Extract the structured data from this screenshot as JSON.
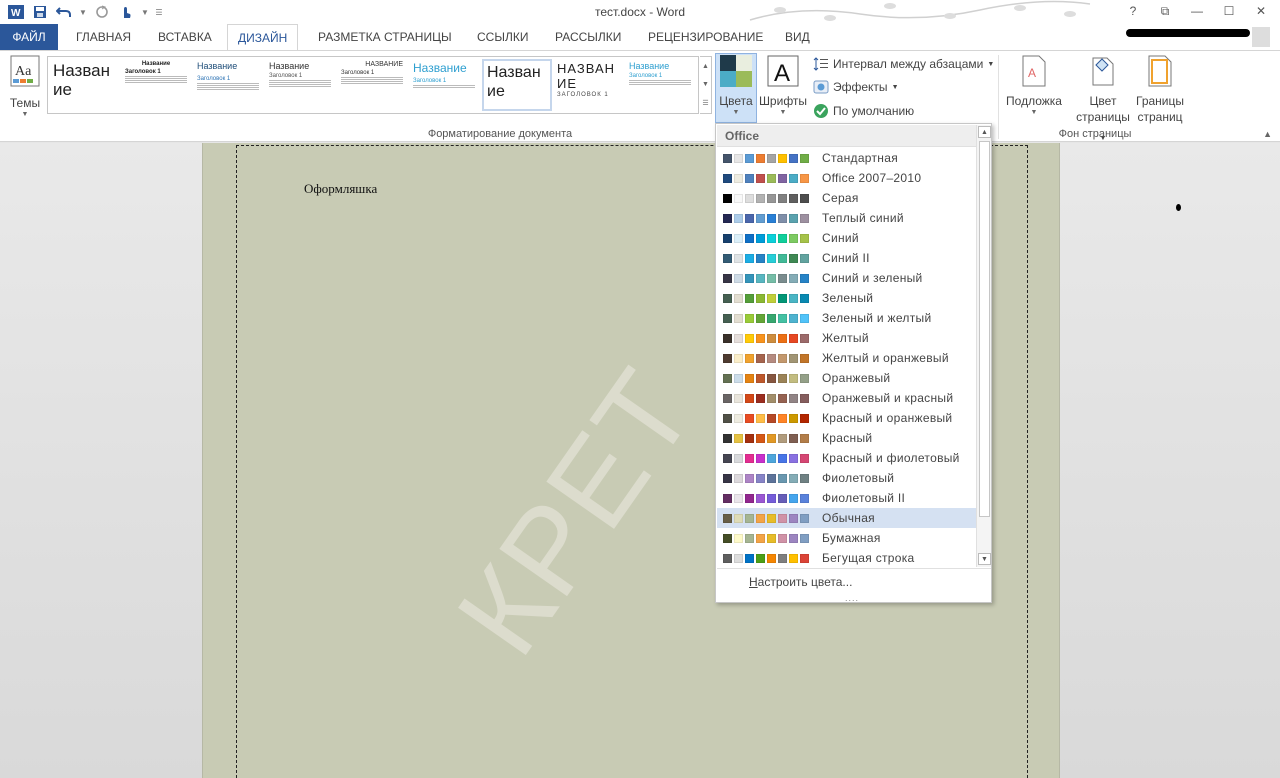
{
  "app": {
    "title": "тест.docx - Word",
    "win_controls": [
      "?",
      "⧉",
      "—",
      "☐",
      "✕"
    ]
  },
  "qat": {
    "word_icon": "W",
    "save_icon": "save-icon",
    "undo_icon": "undo-icon",
    "redo_icon": "redo-icon",
    "touch_icon": "touch-mode-icon"
  },
  "tabs": [
    {
      "label": "ФАЙЛ"
    },
    {
      "label": "ГЛАВНАЯ"
    },
    {
      "label": "ВСТАВКА"
    },
    {
      "label": "ДИЗАЙН"
    },
    {
      "label": "РАЗМЕТКА СТРАНИЦЫ"
    },
    {
      "label": "ССЫЛКИ"
    },
    {
      "label": "РАССЫЛКИ"
    },
    {
      "label": "РЕЦЕНЗИРОВАНИЕ"
    },
    {
      "label": "ВИД"
    }
  ],
  "ribbon": {
    "themes_label": "Темы",
    "colors_label": "Цвета",
    "fonts_label": "Шрифты",
    "paragraph_spacing": "Интервал между абзацами",
    "effects": "Эффекты",
    "set_default": "По умолчанию",
    "doc_format_group": "Форматирование документа",
    "watermark_label": "Подложка",
    "page_color_label_1": "Цвет",
    "page_color_label_2": "страницы",
    "page_borders_label_1": "Границы",
    "page_borders_label_2": "страниц",
    "page_bg_group": "Фон страницы",
    "gallery": [
      {
        "title": "Назван ие",
        "heading": "",
        "sub": ""
      },
      {
        "title": "Название",
        "heading": "Заголовок 1",
        "sub": ""
      },
      {
        "title": "Название",
        "heading": "Заголовок 1",
        "sub": ""
      },
      {
        "title": "Название",
        "heading": "Заголовок 1",
        "sub": ""
      },
      {
        "title": "НАЗВАНИЕ",
        "heading": "Заголовок 1",
        "sub": ""
      },
      {
        "title": "Название",
        "heading": "Заголовок 1",
        "sub": ""
      },
      {
        "title": "Назван ие",
        "heading": "",
        "sub": ""
      },
      {
        "title": "НАЗВАН ИЕ",
        "heading": "ЗАГОЛОВОК 1",
        "sub": ""
      },
      {
        "title": "Название",
        "heading": "Заголовок 1",
        "sub": ""
      }
    ]
  },
  "document": {
    "text": "Оформляшка",
    "watermark": "КРЕТ"
  },
  "colors_dropdown": {
    "header": "Office",
    "customize": "Настроить цвета...",
    "grip": "....",
    "schemes": [
      {
        "name": "Стандартная",
        "colors": [
          "#44546a",
          "#e7e6e6",
          "#5b9bd5",
          "#ed7d31",
          "#a5a5a5",
          "#ffc000",
          "#4472c4",
          "#70ad47"
        ]
      },
      {
        "name": "Office 2007–2010",
        "colors": [
          "#1f497d",
          "#eeece1",
          "#4f81bd",
          "#c0504d",
          "#9bbb59",
          "#8064a2",
          "#4bacc6",
          "#f79646"
        ]
      },
      {
        "name": "Серая",
        "colors": [
          "#000000",
          "#f8f8f8",
          "#dddddd",
          "#b2b2b2",
          "#969696",
          "#808080",
          "#5f5f5f",
          "#4d4d4d"
        ]
      },
      {
        "name": "Теплый синий",
        "colors": [
          "#242852",
          "#acccea",
          "#4a66ac",
          "#629dd1",
          "#297fd5",
          "#7f8fa9",
          "#5aa2ae",
          "#9d90a0"
        ]
      },
      {
        "name": "Синий",
        "colors": [
          "#17406d",
          "#dbeff9",
          "#0f6fc6",
          "#009dd9",
          "#0bd0d9",
          "#10cf9b",
          "#7cca62",
          "#a5c249"
        ]
      },
      {
        "name": "Синий II",
        "colors": [
          "#335b74",
          "#dfe3e5",
          "#1cade4",
          "#2683c6",
          "#27ced7",
          "#42ba97",
          "#3e8853",
          "#62a39f"
        ]
      },
      {
        "name": "Синий и зеленый",
        "colors": [
          "#373545",
          "#cedbe6",
          "#3494ba",
          "#58b6c0",
          "#75bda7",
          "#7a8c8e",
          "#84acb6",
          "#2683c6"
        ]
      },
      {
        "name": "Зеленый",
        "colors": [
          "#455f51",
          "#e3ded1",
          "#549e39",
          "#8ab833",
          "#c0cf3a",
          "#029676",
          "#4ab5c4",
          "#0989b1"
        ]
      },
      {
        "name": "Зеленый и желтый",
        "colors": [
          "#455f51",
          "#e3ded1",
          "#99cb38",
          "#63a537",
          "#37a76f",
          "#44c1a3",
          "#4eb3cf",
          "#51c3f9"
        ]
      },
      {
        "name": "Желтый",
        "colors": [
          "#39302a",
          "#e5dedb",
          "#ffca08",
          "#f8931d",
          "#ce8d3e",
          "#ec7016",
          "#e64823",
          "#9c6a6a"
        ]
      },
      {
        "name": "Желтый и оранжевый",
        "colors": [
          "#4e3b30",
          "#fbeec9",
          "#f0a22e",
          "#a5644e",
          "#b58b80",
          "#c3986d",
          "#a19574",
          "#c17529"
        ]
      },
      {
        "name": "Оранжевый",
        "colors": [
          "#637052",
          "#ccddea",
          "#e48312",
          "#bd582c",
          "#865640",
          "#9b8357",
          "#c2bc80",
          "#94a088"
        ]
      },
      {
        "name": "Оранжевый и красный",
        "colors": [
          "#696464",
          "#e9e5dc",
          "#d34817",
          "#9b2d1f",
          "#a28e6a",
          "#956251",
          "#918485",
          "#855d5d"
        ]
      },
      {
        "name": "Красный и оранжевый",
        "colors": [
          "#505046",
          "#eeece1",
          "#e84c22",
          "#ffbd47",
          "#b64926",
          "#ff8427",
          "#cc9900",
          "#b22600"
        ]
      },
      {
        "name": "Красный",
        "colors": [
          "#323232",
          "#e5c243",
          "#a5300f",
          "#d55816",
          "#e19825",
          "#b19c7d",
          "#7f5f52",
          "#b27d49"
        ]
      },
      {
        "name": "Красный и фиолетовый",
        "colors": [
          "#454551",
          "#d8d9dc",
          "#e32d91",
          "#c830cc",
          "#4ea6dc",
          "#4775e7",
          "#8971e1",
          "#d54773"
        ]
      },
      {
        "name": "Фиолетовый",
        "colors": [
          "#373545",
          "#dcd8dc",
          "#ad84c6",
          "#8784c7",
          "#5d739a",
          "#6997af",
          "#84acb6",
          "#6f8183"
        ]
      },
      {
        "name": "Фиолетовый II",
        "colors": [
          "#632e62",
          "#eae5eb",
          "#92278f",
          "#9b57d3",
          "#755dd9",
          "#665eb8",
          "#45a5ed",
          "#5982db"
        ]
      },
      {
        "name": "Обычная",
        "colors": [
          "#675e47",
          "#dfdcb7",
          "#a5b592",
          "#f3a447",
          "#e7bc29",
          "#d092a7",
          "#9c85c0",
          "#809ec2"
        ]
      },
      {
        "name": "Бумажная",
        "colors": [
          "#444d26",
          "#fefac9",
          "#a5b592",
          "#f3a447",
          "#e7bc29",
          "#d092a7",
          "#9c85c0",
          "#809ec2"
        ]
      },
      {
        "name": "Бегущая строка",
        "colors": [
          "#5e5e5e",
          "#dddddd",
          "#0072c6",
          "#4c9f16",
          "#f58602",
          "#7f7f7f",
          "#ffc000",
          "#db4437"
        ]
      }
    ],
    "highlighted_index": 18
  }
}
